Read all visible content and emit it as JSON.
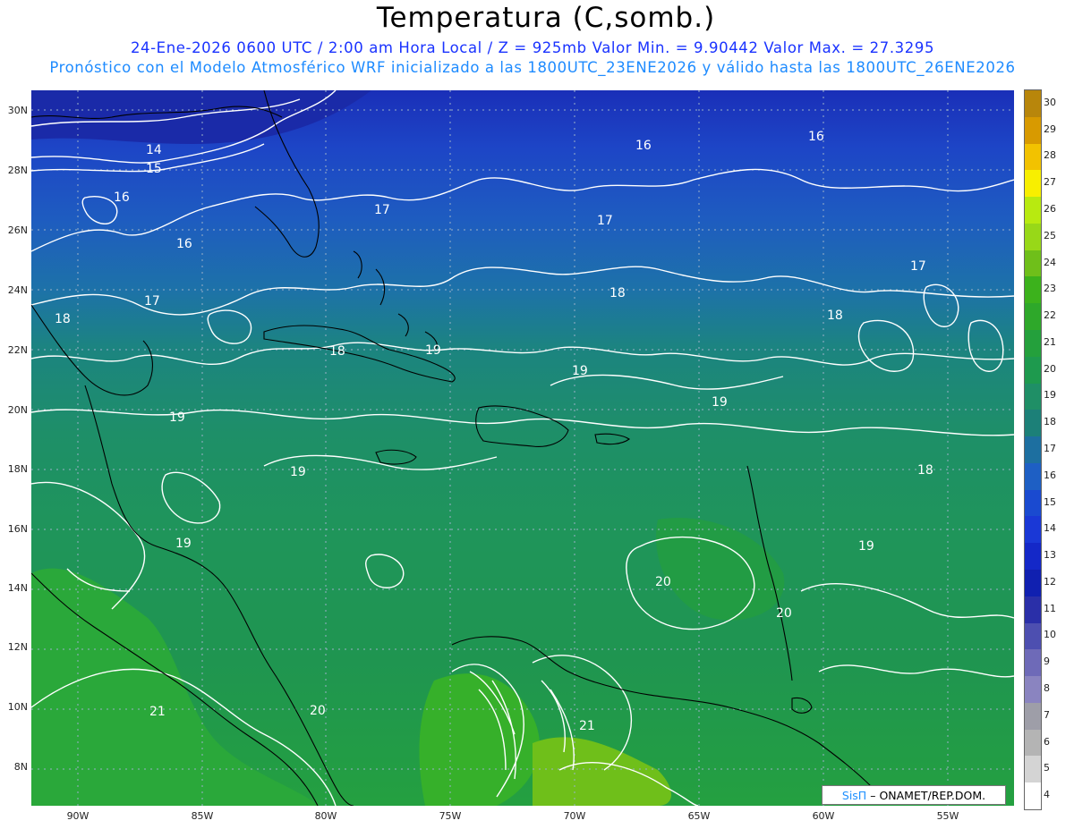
{
  "title": "Temperatura (C,somb.)",
  "subtitle_line1": "24-Ene-2026  0600 UTC / 2:00 am Hora Local / Z = 925mb    Valor Min. = 9.90442  Valor Max. = 27.3295",
  "subtitle_line2": "Pronóstico con el Modelo Atmosférico WRF inicializado a las 1800UTC_23ENE2026 y válido hasta las  1800UTC_26ENE2026",
  "y_axis_labels": [
    "30N",
    "28N",
    "26N",
    "24N",
    "22N",
    "20N",
    "18N",
    "16N",
    "14N",
    "12N",
    "10N",
    "8N"
  ],
  "x_axis_labels": [
    "90W",
    "85W",
    "80W",
    "75W",
    "70W",
    "65W",
    "60W",
    "55W"
  ],
  "contour_labels": [
    "14",
    "15",
    "16",
    "16",
    "16",
    "16",
    "17",
    "17",
    "17",
    "17",
    "18",
    "18",
    "18",
    "18",
    "18",
    "19",
    "19",
    "19",
    "19",
    "19",
    "19",
    "19",
    "20",
    "20",
    "20",
    "21",
    "21"
  ],
  "colorbar": {
    "labels": [
      "30",
      "29",
      "28",
      "27",
      "26",
      "25",
      "24",
      "23",
      "22",
      "21",
      "20",
      "19",
      "18",
      "17",
      "16",
      "15",
      "14",
      "13",
      "12",
      "11",
      "10",
      "9",
      "8",
      "7",
      "6",
      "5",
      "4"
    ],
    "colors": [
      "#b8860b",
      "#d89a00",
      "#f2c200",
      "#f8ef00",
      "#b8ea10",
      "#98d818",
      "#6fbf1a",
      "#3cb21c",
      "#2ea82a",
      "#24a03c",
      "#1e9a4e",
      "#1f8f66",
      "#1c8078",
      "#1d6fa0",
      "#1e5fc4",
      "#1a4ad0",
      "#1a38d6",
      "#1428c8",
      "#1020b0",
      "#2a2fa8",
      "#4d4fb0",
      "#6e6ab8",
      "#8a84c0",
      "#9e9ea8",
      "#b4b4b4",
      "#d4d4d4",
      "#ffffff"
    ]
  },
  "credit": {
    "logo": "SisΠ",
    "text": "– ONAMET/REP.DOM."
  },
  "colors": {
    "title": "#000000",
    "subtitle1": "#1a33ff",
    "subtitle2": "#1e8bff",
    "contour": "#ffffff",
    "coast": "#000000"
  }
}
